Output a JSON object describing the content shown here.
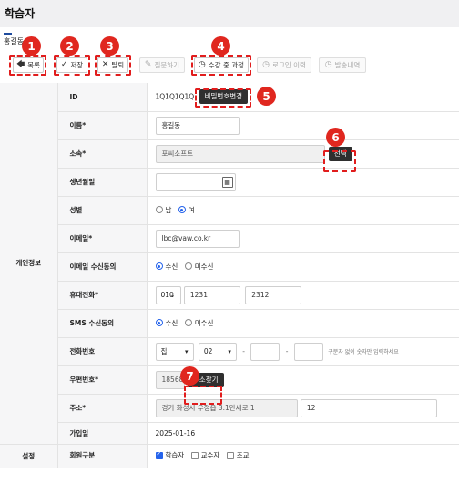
{
  "page": {
    "title": "학습자",
    "tab": "홍길동"
  },
  "toolbar": {
    "back": "목록",
    "save": "저장",
    "delete": "탈퇴",
    "question": "질문하기",
    "courses": "수강 중 과정",
    "login_history": "로그인 이력",
    "send_history": "발송내역"
  },
  "callouts": [
    "1",
    "2",
    "3",
    "4",
    "5",
    "6",
    "7"
  ],
  "sections": {
    "personal": "개인정보",
    "settings": "설정"
  },
  "fields": {
    "id": {
      "label": "ID",
      "value": "1Q1Q1Q1Q",
      "button": "비밀번호변경"
    },
    "name": {
      "label": "이름*",
      "value": "홍길동"
    },
    "affiliation": {
      "label": "소속*",
      "value": "포씨소프트",
      "button": "선택"
    },
    "birth": {
      "label": "생년월일",
      "value": ""
    },
    "gender": {
      "label": "성별",
      "options": [
        "남",
        "여"
      ],
      "selected": "여"
    },
    "email": {
      "label": "이메일*",
      "value": "lbc@vaw.co.kr"
    },
    "email_consent": {
      "label": "이메일 수신동의",
      "options": [
        "수신",
        "미수신"
      ],
      "selected": "수신"
    },
    "mobile": {
      "label": "휴대전화*",
      "prefix": "010",
      "middle": "1231",
      "last": "2312"
    },
    "sms_consent": {
      "label": "SMS 수신동의",
      "options": [
        "수신",
        "미수신"
      ],
      "selected": "수신"
    },
    "phone": {
      "label": "전화번호",
      "type": "집",
      "area": "02",
      "middle": "",
      "last": "",
      "hint": "구분자 없이 숫자만 입력하세요"
    },
    "postal": {
      "label": "우편번호*",
      "value": "18568",
      "button": "주소찾기"
    },
    "address": {
      "label": "주소*",
      "value": "경기 화성시 우정읍 3.1만세로 1",
      "detail": "12"
    },
    "joined": {
      "label": "가입일",
      "value": "2025-01-16"
    },
    "member_type": {
      "label": "회원구분",
      "options": [
        "학습자",
        "교수자",
        "조교"
      ],
      "checked": [
        "학습자"
      ]
    }
  },
  "colors": {
    "accent": "#2563eb",
    "callout": "#e0271f",
    "dark_button": "#2f2f2f"
  },
  "icons": [
    "back-arrow-icon",
    "check-icon",
    "x-icon",
    "edit-icon",
    "clock-icon",
    "calendar-icon",
    "caret-down-icon"
  ]
}
